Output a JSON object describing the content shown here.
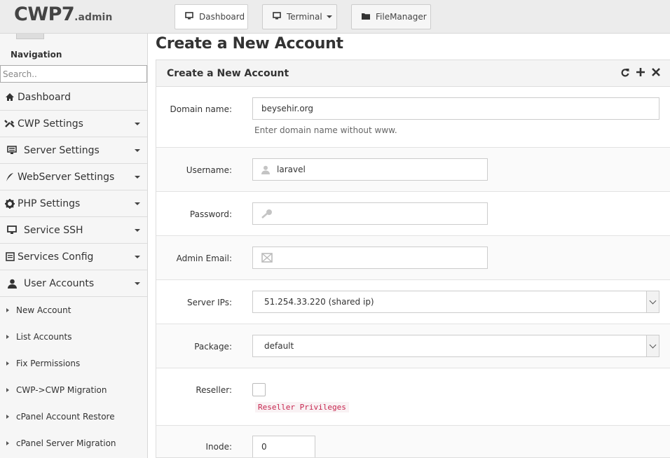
{
  "app": {
    "brand": "CWP7",
    "brand_suffix": ".admin"
  },
  "toolbar": {
    "dashboard_label": "Dashboard",
    "terminal_label": "Terminal",
    "filemanager_label": "FileManager"
  },
  "sidebar": {
    "title": "Navigation",
    "search_placeholder": "Search..",
    "items": [
      {
        "label": "Dashboard",
        "icon": "home-icon",
        "has_caret": false
      },
      {
        "label": "CWP Settings",
        "icon": "tools-icon",
        "has_caret": true
      },
      {
        "label": "Server Settings",
        "icon": "server-icon",
        "has_caret": true
      },
      {
        "label": "WebServer Settings",
        "icon": "feather-icon",
        "has_caret": true
      },
      {
        "label": "PHP Settings",
        "icon": "gear-icon",
        "has_caret": true
      },
      {
        "label": "Service SSH",
        "icon": "monitor-icon",
        "has_caret": true
      },
      {
        "label": "Services Config",
        "icon": "services-icon",
        "has_caret": true
      },
      {
        "label": "User Accounts",
        "icon": "user-icon",
        "has_caret": true
      }
    ],
    "subitems": [
      "New Account",
      "List Accounts",
      "Fix Permissions",
      "CWP->CWP Migration",
      "cPanel Account Restore",
      "cPanel Server Migration"
    ]
  },
  "main": {
    "page_title": "Create a New Account",
    "panel_title": "Create a New Account",
    "panel_tools": [
      "refresh-icon",
      "plus-icon",
      "close-icon"
    ],
    "form": {
      "domain": {
        "label": "Domain name:",
        "value": "beysehir.org",
        "help": "Enter domain name without www."
      },
      "username": {
        "label": "Username:",
        "value": "laravel"
      },
      "password": {
        "label": "Password:",
        "value": ""
      },
      "email": {
        "label": "Admin Email:",
        "value": ""
      },
      "server_ips": {
        "label": "Server IPs:",
        "value": "51.254.33.220 (shared ip)"
      },
      "package": {
        "label": "Package:",
        "value": "default"
      },
      "reseller": {
        "label": "Reseller:",
        "checked": false,
        "note": "Reseller Privileges"
      },
      "inode": {
        "label": "Inode:",
        "value": "0"
      }
    }
  },
  "colors": {
    "accent_code": "#c7254e",
    "code_bg": "#f9f2f4",
    "sidebar_bg": "#f6f6f6",
    "topbar_bg": "#ececec"
  }
}
